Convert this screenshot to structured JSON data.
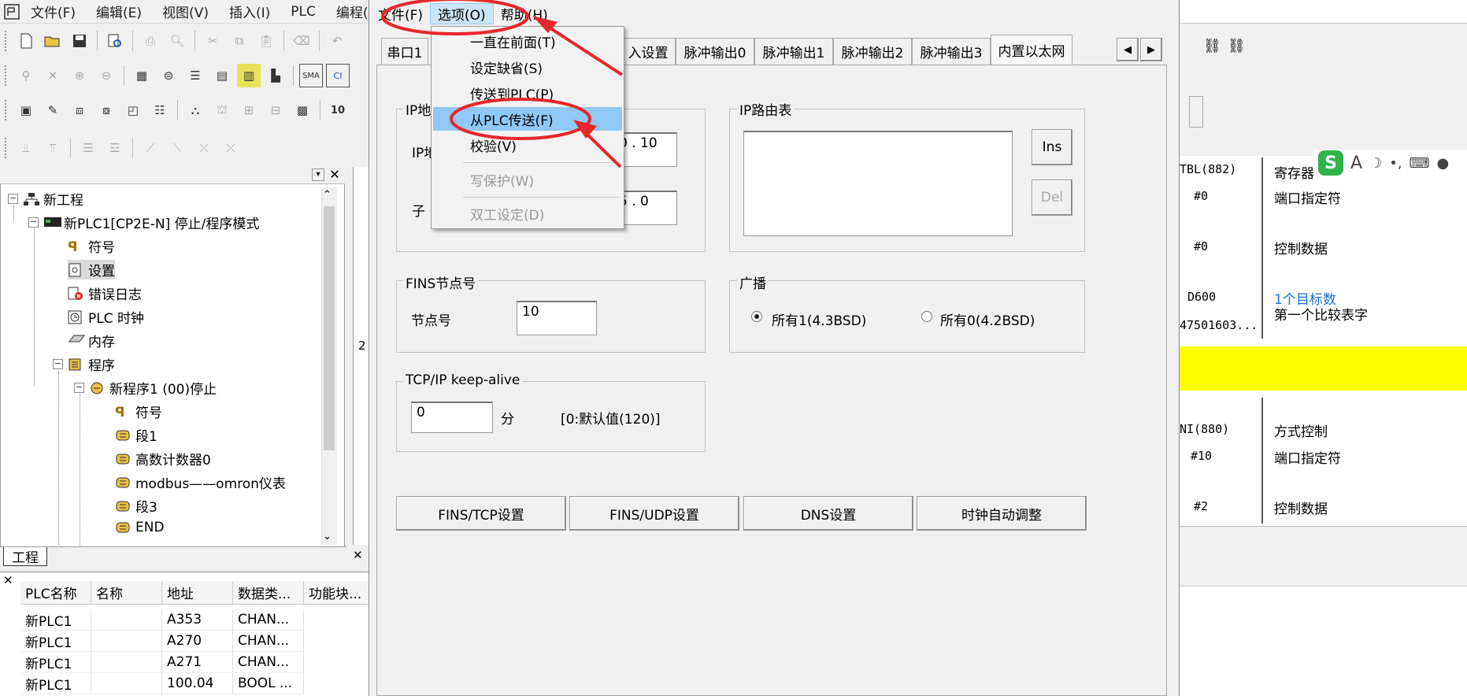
{
  "main_menu": [
    "文件(F)",
    "编辑(E)",
    "视图(V)",
    "插入(I)",
    "PLC",
    "编程(P)"
  ],
  "tree": {
    "items": [
      {
        "label": "新工程",
        "icon": "network-icon"
      },
      {
        "label": "新PLC1[CP2E-N] 停止/程序模式",
        "icon": "plc-icon"
      },
      {
        "label": "符号",
        "icon": "symbol-icon"
      },
      {
        "label": "设置",
        "icon": "settings-icon"
      },
      {
        "label": "错误日志",
        "icon": "error-log-icon"
      },
      {
        "label": "PLC 时钟",
        "icon": "clock-icon"
      },
      {
        "label": "内存",
        "icon": "memory-icon"
      },
      {
        "label": "程序",
        "icon": "programs-icon"
      },
      {
        "label": "新程序1 (00)停止",
        "icon": "program-icon"
      },
      {
        "label": "符号",
        "icon": "symbol-icon"
      },
      {
        "label": "段1",
        "icon": "section-icon"
      },
      {
        "label": "高数计数器0",
        "icon": "section-icon"
      },
      {
        "label": "modbus——omron仪表",
        "icon": "section-icon"
      },
      {
        "label": "段3",
        "icon": "section-icon"
      },
      {
        "label": "END",
        "icon": "section-icon"
      }
    ],
    "tab_label": "工程"
  },
  "bottom_table": {
    "headers": [
      "PLC名称",
      "名称",
      "地址",
      "数据类...",
      "功能块..."
    ],
    "rows": [
      [
        "新PLC1",
        "",
        "A353",
        "CHAN...",
        ""
      ],
      [
        "新PLC1",
        "",
        "A270",
        "CHAN...",
        ""
      ],
      [
        "新PLC1",
        "",
        "A271",
        "CHAN...",
        ""
      ],
      [
        "新PLC1",
        "",
        "100.04",
        "BOOL ...",
        ""
      ]
    ]
  },
  "dialog": {
    "menu": [
      "文件(F)",
      "选项(O)",
      "帮助(H)"
    ],
    "tabs": [
      "串口1",
      "入设置",
      "脉冲输出0",
      "脉冲输出1",
      "脉冲输出2",
      "脉冲输出3",
      "内置以太网"
    ],
    "ip_group": {
      "title": "IP地",
      "ip_label": "IP地",
      "ip_value": "0 . 10",
      "subnet_label": "子",
      "subnet_value": "5 . 0"
    },
    "ip_router": {
      "title": "IP路由表",
      "ins": "Ins",
      "del": "Del"
    },
    "fins": {
      "title": "FINS节点号",
      "label": "节点号",
      "value": "10"
    },
    "broadcast": {
      "title": "广播",
      "opt1": "所有1(4.3BSD)",
      "opt2": "所有0(4.2BSD)",
      "selected": "opt1"
    },
    "keepalive": {
      "title": "TCP/IP keep-alive",
      "value": "0",
      "unit": "分",
      "hint": "[0:默认值(120)]"
    },
    "buttons": [
      "FINS/TCP设置",
      "FINS/UDP设置",
      "DNS设置",
      "时钟自动调整"
    ]
  },
  "dropdown": {
    "items": [
      {
        "label": "一直在前面(T)",
        "state": "normal"
      },
      {
        "label": "设定缺省(S)",
        "state": "normal"
      },
      {
        "label": "传送到PLC(P)",
        "state": "normal"
      },
      {
        "label": "从PLC传送(F)",
        "state": "highlighted"
      },
      {
        "label": "校验(V)",
        "state": "normal"
      },
      {
        "label": "写保护(W)",
        "state": "disabled"
      },
      {
        "label": "双工设定(D)",
        "state": "disabled"
      }
    ]
  },
  "right_panel": {
    "rows": [
      {
        "a": "TBL(882)",
        "b": "寄存器"
      },
      {
        "a": "#0",
        "b": "端口指定符"
      },
      {
        "a": "#0",
        "b": "控制数据"
      },
      {
        "a": "D600",
        "b": "1个目标数",
        "c": "第一个比较表字"
      },
      {
        "a": "47501603...",
        "b": ""
      },
      {
        "a": "NI(880)",
        "b": "方式控制"
      },
      {
        "a": "#10",
        "b": "端口指定符"
      },
      {
        "a": "#2",
        "b": "控制数据"
      }
    ],
    "row_number": "2"
  },
  "colors": {
    "highlight": "#90c8f6",
    "annotation": "#e8262b",
    "yellow": "#ffff00",
    "blue_text": "#1a6fd4"
  }
}
